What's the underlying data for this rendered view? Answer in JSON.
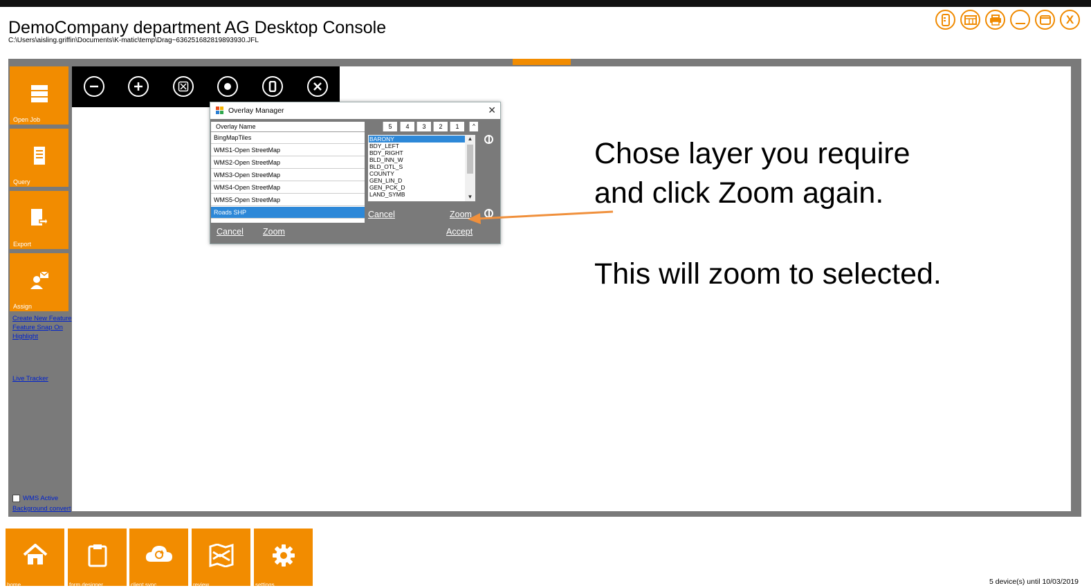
{
  "app": {
    "title": "DemoCompany department AG Desktop Console",
    "path": "C:\\Users\\aisling.griffin\\Documents\\K-matic\\temp\\Drag~636251682819893930.JFL"
  },
  "window_controls": [
    {
      "icon": "panel-icon"
    },
    {
      "icon": "table-icon"
    },
    {
      "icon": "print-icon"
    },
    {
      "icon": "minimize-icon"
    },
    {
      "icon": "maximize-icon"
    },
    {
      "icon": "close-icon",
      "label": "X"
    }
  ],
  "sidebar": {
    "tiles": [
      {
        "label": "Open Job",
        "icon": "server-icon"
      },
      {
        "label": "Query",
        "icon": "document-icon"
      },
      {
        "label": "Export",
        "icon": "export-icon"
      },
      {
        "label": "Assign",
        "icon": "assign-user-icon"
      }
    ],
    "links": [
      "Create New Feature",
      "Feature Snap On",
      "Highlight",
      "Live Tracker"
    ],
    "wms_label": "WMS Active",
    "background_link": "Background convert"
  },
  "map_toolbar": [
    {
      "icon": "zoom-out-icon"
    },
    {
      "icon": "zoom-in-icon"
    },
    {
      "icon": "zoom-extent-icon"
    },
    {
      "icon": "center-icon"
    },
    {
      "icon": "pause-icon"
    },
    {
      "icon": "clear-icon"
    }
  ],
  "overlay_dialog": {
    "title": "Overlay Manager",
    "close_glyph": "✕",
    "header": {
      "name": "Overlay Name",
      "columns": [
        "5",
        "4",
        "3",
        "2",
        "1"
      ],
      "scroll": "^"
    },
    "rows": [
      {
        "name": "BingMapTiles",
        "selected": false
      },
      {
        "name": "WMS1-Open StreetMap",
        "selected": false
      },
      {
        "name": "WMS2-Open StreetMap",
        "selected": false
      },
      {
        "name": "WMS3-Open StreetMap",
        "selected": false
      },
      {
        "name": "WMS4-Open StreetMap",
        "selected": false
      },
      {
        "name": "WMS5-Open StreetMap",
        "selected": false
      },
      {
        "name": "Roads SHP",
        "selected": true
      }
    ],
    "layers": [
      "BARONY",
      "BDY_LEFT",
      "BDY_RIGHT",
      "BLD_INN_W",
      "BLD_OTL_S",
      "COUNTY",
      "GEN_LIN_D",
      "GEN_PCK_D",
      "LAND_SYMB"
    ],
    "selected_layer": "BARONY",
    "layer_cancel": "Cancel",
    "layer_zoom": "Zoom",
    "cancel": "Cancel",
    "zoom": "Zoom",
    "accept": "Accept"
  },
  "annotation": {
    "line1": "Chose layer you require",
    "line2": "and click Zoom again.",
    "line3": "This will zoom to selected.",
    "arrow_color": "#f0903c"
  },
  "bottom_nav": [
    {
      "label": "home",
      "icon": "home-icon"
    },
    {
      "label": "form designer",
      "icon": "clipboard-icon"
    },
    {
      "label": "client sync",
      "icon": "cloud-sync-icon"
    },
    {
      "label": "review",
      "icon": "map-review-icon"
    },
    {
      "label": "settings",
      "icon": "gear-icon"
    }
  ],
  "license": "5 device(s) until 10/03/2019",
  "colors": {
    "accent": "#f28c00",
    "frame": "#7a7a7a",
    "selection": "#2d88d8",
    "link": "#0022cc"
  }
}
